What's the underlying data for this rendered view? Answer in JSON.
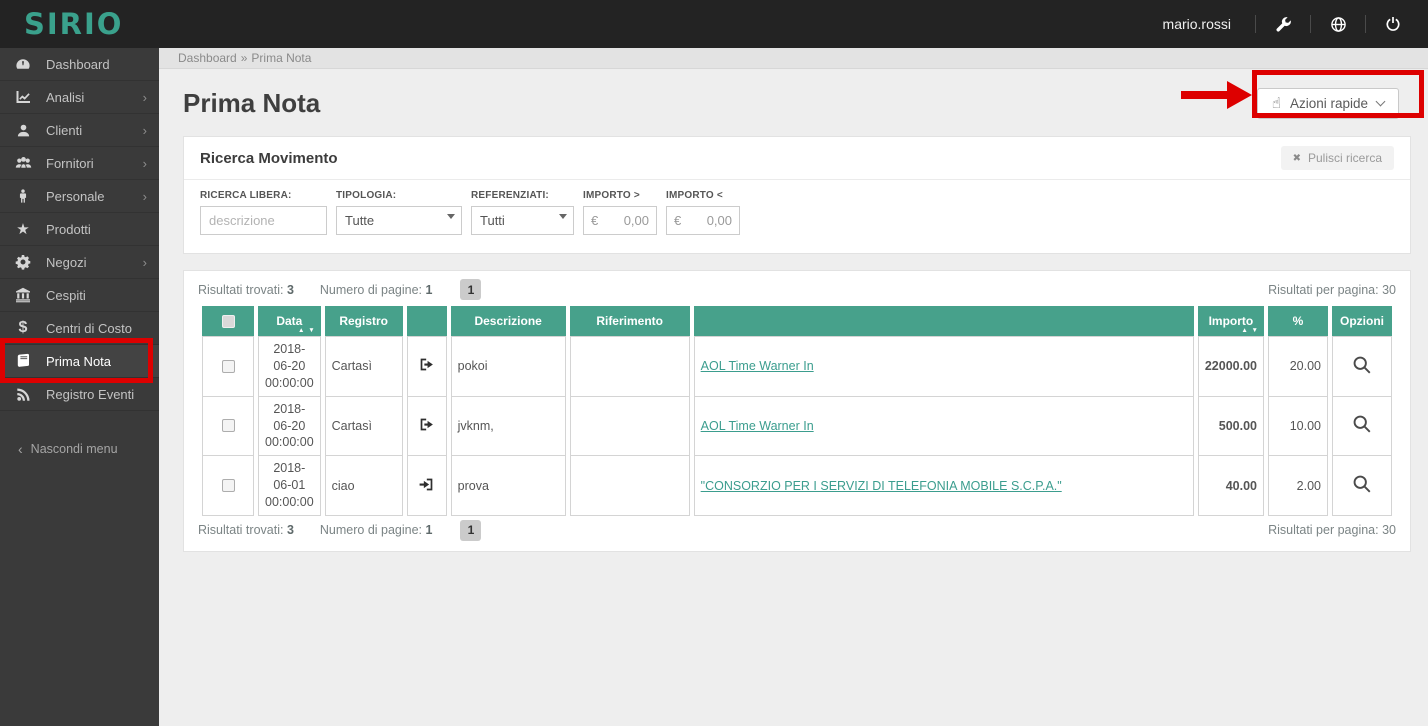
{
  "colors": {
    "topbar_bg": "#232323",
    "sidebar_bg": "#3a3a3a",
    "logo_teal": "#3aa18c",
    "table_header_green": "#47a18b",
    "amount_green": "#0a8f0a",
    "link_teal": "#3b9d8e",
    "annotation_red": "#dd0000"
  },
  "topbar": {
    "logo": "SIRIO",
    "username": "mario.rossi",
    "icons": [
      "wrench-icon",
      "globe-icon",
      "power-icon"
    ]
  },
  "sidebar": {
    "items": [
      {
        "label": "Dashboard",
        "icon": "dashboard-icon",
        "submenu": false,
        "active": false
      },
      {
        "label": "Analisi",
        "icon": "line-chart-icon",
        "submenu": true,
        "active": false
      },
      {
        "label": "Clienti",
        "icon": "user-icon",
        "submenu": true,
        "active": false
      },
      {
        "label": "Fornitori",
        "icon": "users-icon",
        "submenu": true,
        "active": false
      },
      {
        "label": "Personale",
        "icon": "person-icon",
        "submenu": true,
        "active": false
      },
      {
        "label": "Prodotti",
        "icon": "star-icon",
        "glyph": "★",
        "submenu": false,
        "active": false
      },
      {
        "label": "Negozi",
        "icon": "gear-icon",
        "submenu": true,
        "active": false
      },
      {
        "label": "Cespiti",
        "icon": "bank-icon",
        "submenu": false,
        "active": false
      },
      {
        "label": "Centri di Costo",
        "icon": "dollar-icon",
        "glyph": "$",
        "submenu": false,
        "active": false
      },
      {
        "label": "Prima Nota",
        "icon": "book-icon",
        "submenu": false,
        "active": true
      },
      {
        "label": "Registro Eventi",
        "icon": "rss-icon",
        "submenu": false,
        "active": false
      }
    ],
    "submenu_chevron": "›",
    "collapse_chevron": "‹",
    "collapse_label": "Nascondi menu"
  },
  "breadcrumb": {
    "home": "Dashboard",
    "separator": "»",
    "current": "Prima Nota"
  },
  "page": {
    "title": "Prima Nota"
  },
  "quick_actions": {
    "label": "Azioni rapide",
    "icon": "hand-pointer-icon",
    "glyph": "☝"
  },
  "search_panel": {
    "title": "Ricerca Movimento",
    "clear_button": {
      "label": "Pulisci ricerca",
      "icon": "clear-icon",
      "glyph": "✖"
    },
    "fields": {
      "ricerca_libera": {
        "label": "RICERCA LIBERA:",
        "placeholder": "descrizione"
      },
      "tipologia": {
        "label": "TIPOLOGIA:",
        "value": "Tutte"
      },
      "referenziati": {
        "label": "REFERENZIATI:",
        "value": "Tutti"
      },
      "importo_gt": {
        "label": "IMPORTO >",
        "prefix": "€",
        "value": "0,00"
      },
      "importo_lt": {
        "label": "IMPORTO <",
        "prefix": "€",
        "value": "0,00"
      }
    }
  },
  "results": {
    "found_label": "Risultati trovati:",
    "found_value": "3",
    "pages_label": "Numero di pagine:",
    "pages_value": "1",
    "page_button": "1",
    "per_page_label": "Risultati per pagina:",
    "per_page_value": "30"
  },
  "table": {
    "sort_indicator": "▲ ▼",
    "headers": {
      "data": "Data",
      "registro": "Registro",
      "descrizione": "Descrizione",
      "riferimento": "Riferimento",
      "importo": "Importo",
      "percent": "%",
      "opzioni": "Opzioni"
    },
    "rows": [
      {
        "data": "2018-06-20 00:00:00",
        "registro": "Cartasì",
        "direction": "sign-out-icon",
        "descrizione": "pokoi",
        "riferimento": "",
        "link": "AOL Time Warner In",
        "importo": "22000.00",
        "percent": "20.00",
        "option": "magnifier-icon"
      },
      {
        "data": "2018-06-20 00:00:00",
        "registro": "Cartasì",
        "direction": "sign-out-icon",
        "descrizione": "jvknm,",
        "riferimento": "",
        "link": "AOL Time Warner In",
        "importo": "500.00",
        "percent": "10.00",
        "option": "magnifier-icon"
      },
      {
        "data": "2018-06-01 00:00:00",
        "registro": "ciao",
        "direction": "sign-in-icon",
        "descrizione": "prova",
        "riferimento": "",
        "link": "\"CONSORZIO PER I SERVIZI DI TELEFONIA MOBILE S.C.P.A.\"",
        "importo": "40.00",
        "percent": "2.00",
        "option": "magnifier-icon"
      }
    ]
  }
}
